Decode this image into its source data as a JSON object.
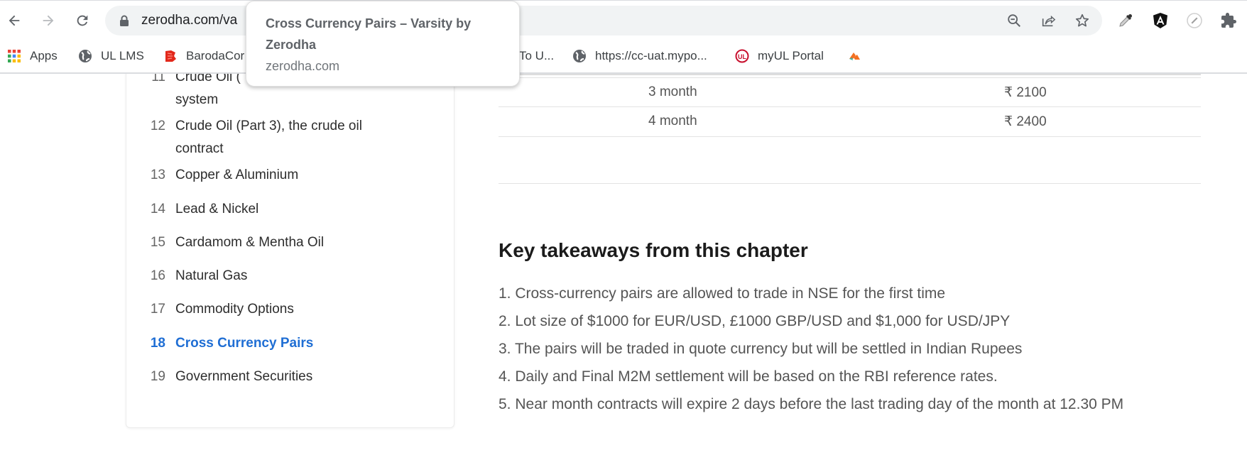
{
  "browser": {
    "url": "zerodha.com/va",
    "nav": {
      "back_icon": "arrow-left-icon",
      "forward_icon": "arrow-right-icon",
      "reload_icon": "reload-icon"
    },
    "omnibox_icons": [
      "zoom-out-icon",
      "share-icon",
      "star-icon"
    ],
    "extensions": [
      "eyedropper-icon",
      "angular-icon",
      "ruler-icon",
      "puzzle-icon"
    ],
    "bookmarks": [
      {
        "label": "Apps",
        "icon": "apps-grid-icon"
      },
      {
        "label": "UL LMS",
        "icon": "globe-icon"
      },
      {
        "label": "BarodaCor",
        "icon": "baroda-icon"
      },
      {
        "label": "To U...",
        "icon": ""
      },
      {
        "label": "https://cc-uat.mypo...",
        "icon": "globe-icon"
      },
      {
        "label": "myUL Portal",
        "icon": "ul-icon"
      },
      {
        "label": "",
        "icon": "bookmark-logo-icon"
      }
    ],
    "tooltip": {
      "title": "Cross Currency Pairs – Varsity by Zerodha",
      "domain": "zerodha.com"
    }
  },
  "sidebar": {
    "chapters": [
      {
        "num": "11",
        "title": "Crude Oil (",
        "title_line2": "system",
        "active": false
      },
      {
        "num": "12",
        "title": "Crude Oil (Part 3), the crude oil contract",
        "active": false
      },
      {
        "num": "13",
        "title": "Copper & Aluminium",
        "active": false
      },
      {
        "num": "14",
        "title": "Lead & Nickel",
        "active": false
      },
      {
        "num": "15",
        "title": "Cardamom & Mentha Oil",
        "active": false
      },
      {
        "num": "16",
        "title": "Natural Gas",
        "active": false
      },
      {
        "num": "17",
        "title": "Commodity Options",
        "active": false
      },
      {
        "num": "18",
        "title": "Cross Currency Pairs",
        "active": true
      },
      {
        "num": "19",
        "title": "Government Securities",
        "active": false
      }
    ],
    "active_color": "#1f6ed4"
  },
  "main": {
    "table": {
      "rows": [
        {
          "duration": "3 month",
          "price": "₹ 2100"
        },
        {
          "duration": "4 month",
          "price": "₹ 2400"
        }
      ]
    },
    "takeaways": {
      "heading": "Key takeaways from this chapter",
      "items": [
        "1. Cross-currency pairs are allowed to trade in NSE for the first time",
        "2. Lot size of $1000 for EUR/USD, £1000 GBP/USD and $1,000 for USD/JPY",
        "3. The pairs will be traded in quote currency but will be settled in Indian Rupees",
        "4. Daily and Final M2M settlement will be based on the RBI reference rates.",
        "5. Near month contracts will expire 2 days before the last trading day of the month at 12.30 PM"
      ]
    }
  }
}
